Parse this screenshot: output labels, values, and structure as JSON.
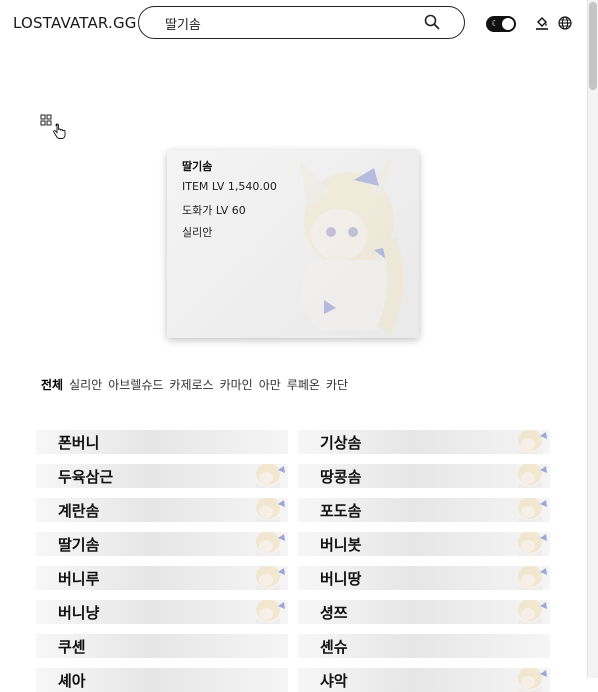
{
  "header": {
    "logo": "LOSTAVATAR.GG",
    "search_value": "딸기솜",
    "theme_toggle_icon": "moon-icon",
    "fill_icon": "paint-bucket-icon",
    "language_icon": "globe-icon"
  },
  "character": {
    "name": "딸기솜",
    "item_level": "ITEM LV 1,540.00",
    "class_level": "도화가 LV 60",
    "server": "실리안"
  },
  "tabs": [
    "전체",
    "실리안",
    "아브렐슈드",
    "카제로스",
    "카마인",
    "아만",
    "루페온",
    "카단"
  ],
  "characters": [
    {
      "name": "폰버니",
      "has_thumb": false
    },
    {
      "name": "기상솜",
      "has_thumb": true
    },
    {
      "name": "두육삼근",
      "has_thumb": true
    },
    {
      "name": "땅콩솜",
      "has_thumb": true
    },
    {
      "name": "계란솜",
      "has_thumb": true
    },
    {
      "name": "포도솜",
      "has_thumb": true
    },
    {
      "name": "딸기솜",
      "has_thumb": true
    },
    {
      "name": "버니봇",
      "has_thumb": true
    },
    {
      "name": "버니루",
      "has_thumb": true
    },
    {
      "name": "버니땅",
      "has_thumb": true
    },
    {
      "name": "버니냥",
      "has_thumb": true
    },
    {
      "name": "셩쯔",
      "has_thumb": true
    },
    {
      "name": "쿠셴",
      "has_thumb": false
    },
    {
      "name": "셴슈",
      "has_thumb": false
    },
    {
      "name": "셰아",
      "has_thumb": false
    },
    {
      "name": "샤악",
      "has_thumb": true
    }
  ],
  "colors": {
    "accent": "#111111",
    "tab_active": "#000000",
    "row_bg": "#e6e6e6"
  }
}
